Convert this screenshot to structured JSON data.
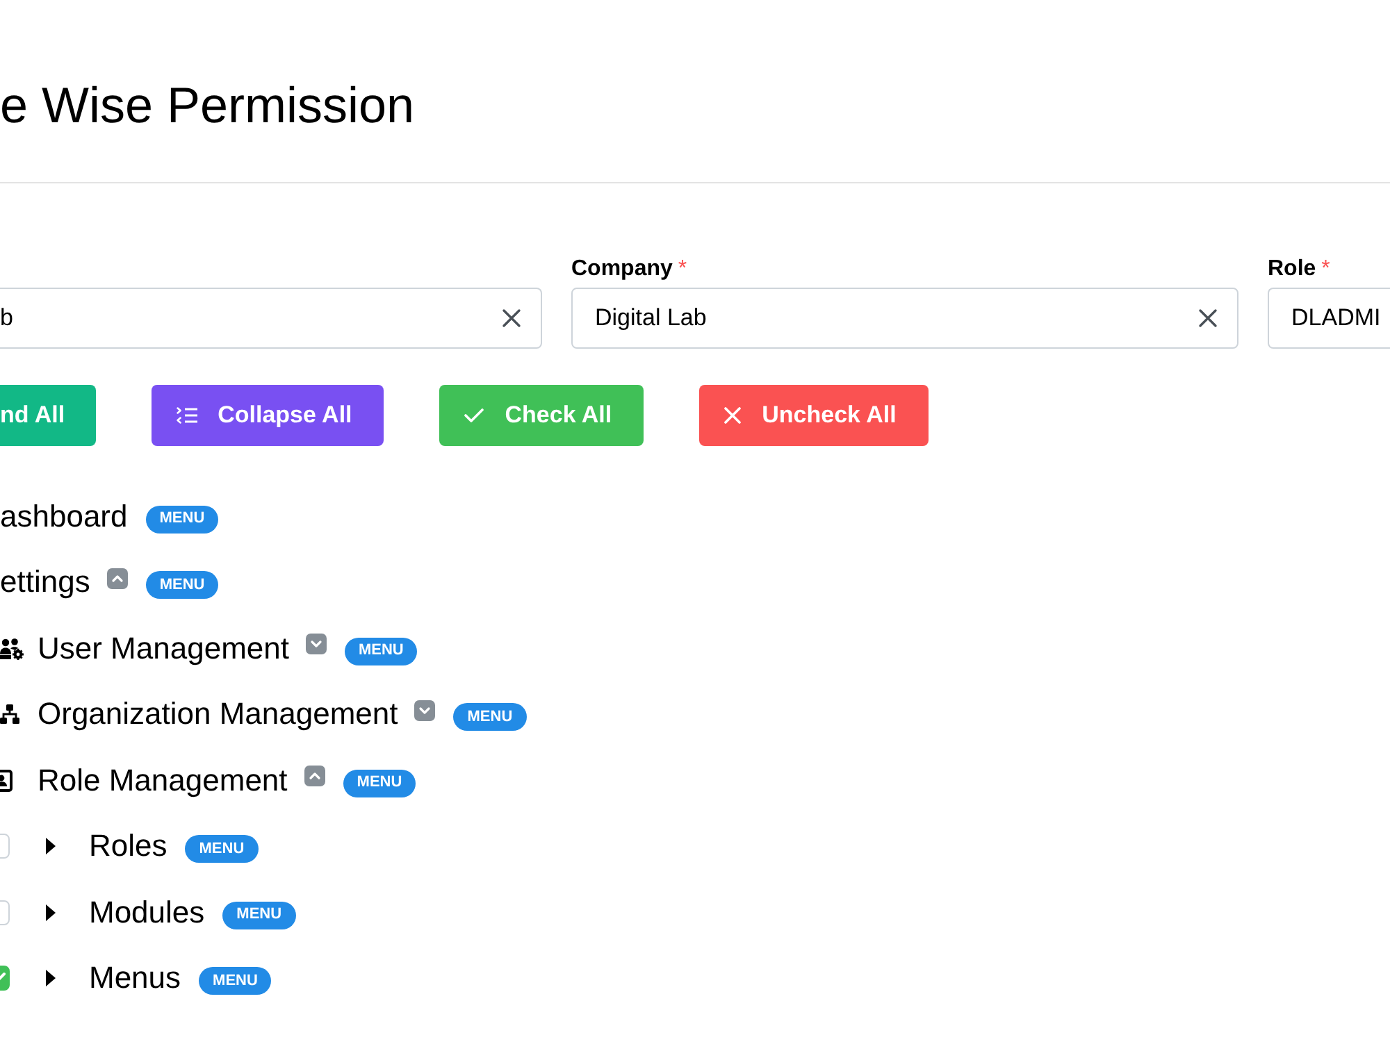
{
  "page": {
    "title": "e Wise Permission"
  },
  "fields": [
    {
      "value": "b",
      "clear_button": true
    },
    {
      "label": "Company",
      "required_mark": "*",
      "value": "Digital Lab",
      "clear_button": true
    },
    {
      "label": "Role",
      "required_mark": "*",
      "value": "DLADMI",
      "clear_button": false
    }
  ],
  "buttons": [
    {
      "label": "nd All",
      "kind": "expand"
    },
    {
      "label": "Collapse All",
      "kind": "collapse"
    },
    {
      "label": "Check All",
      "kind": "check"
    },
    {
      "label": "Uncheck All",
      "kind": "uncheck"
    }
  ],
  "tree": [
    {
      "label": "ashboard",
      "badge": "MENU"
    },
    {
      "label": "ettings",
      "badge": "MENU",
      "expanded": true,
      "children": [
        {
          "label": "User Management",
          "badge": "MENU",
          "expanded": false
        },
        {
          "label": "Organization Management",
          "badge": "MENU",
          "expanded": false
        },
        {
          "label": "Role Management",
          "badge": "MENU",
          "expanded": true,
          "children": [
            {
              "label": "Roles",
              "badge": "MENU",
              "checked": false,
              "caret_open": false
            },
            {
              "label": "Modules",
              "badge": "MENU",
              "checked": false,
              "caret_open": false
            },
            {
              "label": "Menus",
              "badge": "MENU",
              "checked": true,
              "caret_open": false
            }
          ]
        }
      ]
    }
  ]
}
